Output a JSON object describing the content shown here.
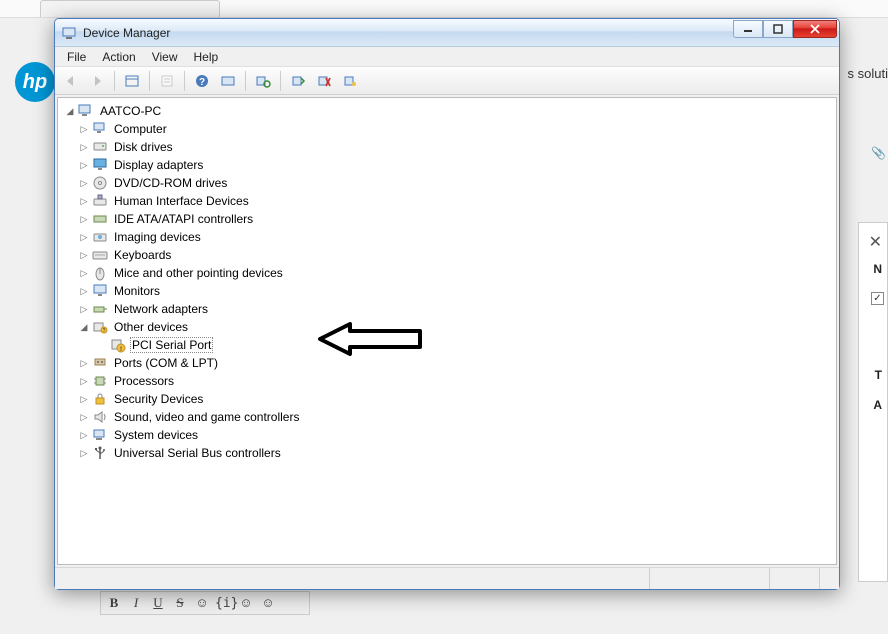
{
  "window": {
    "title": "Device Manager"
  },
  "menu": {
    "file": "File",
    "action": "Action",
    "view": "View",
    "help": "Help"
  },
  "tree": {
    "root": "AATCO-PC",
    "computer": "Computer",
    "diskdrives": "Disk drives",
    "display": "Display adapters",
    "dvd": "DVD/CD-ROM drives",
    "hid": "Human Interface Devices",
    "ide": "IDE ATA/ATAPI controllers",
    "imaging": "Imaging devices",
    "keyboards": "Keyboards",
    "mice": "Mice and other pointing devices",
    "monitors": "Monitors",
    "network": "Network adapters",
    "other": "Other devices",
    "pciserial": "PCI Serial Port",
    "ports": "Ports (COM & LPT)",
    "processors": "Processors",
    "security": "Security Devices",
    "sound": "Sound, video and game controllers",
    "system": "System devices",
    "usb": "Universal Serial Bus controllers"
  },
  "bg": {
    "right_text": "s soluti",
    "N": "N",
    "T": "T",
    "A": "A"
  }
}
